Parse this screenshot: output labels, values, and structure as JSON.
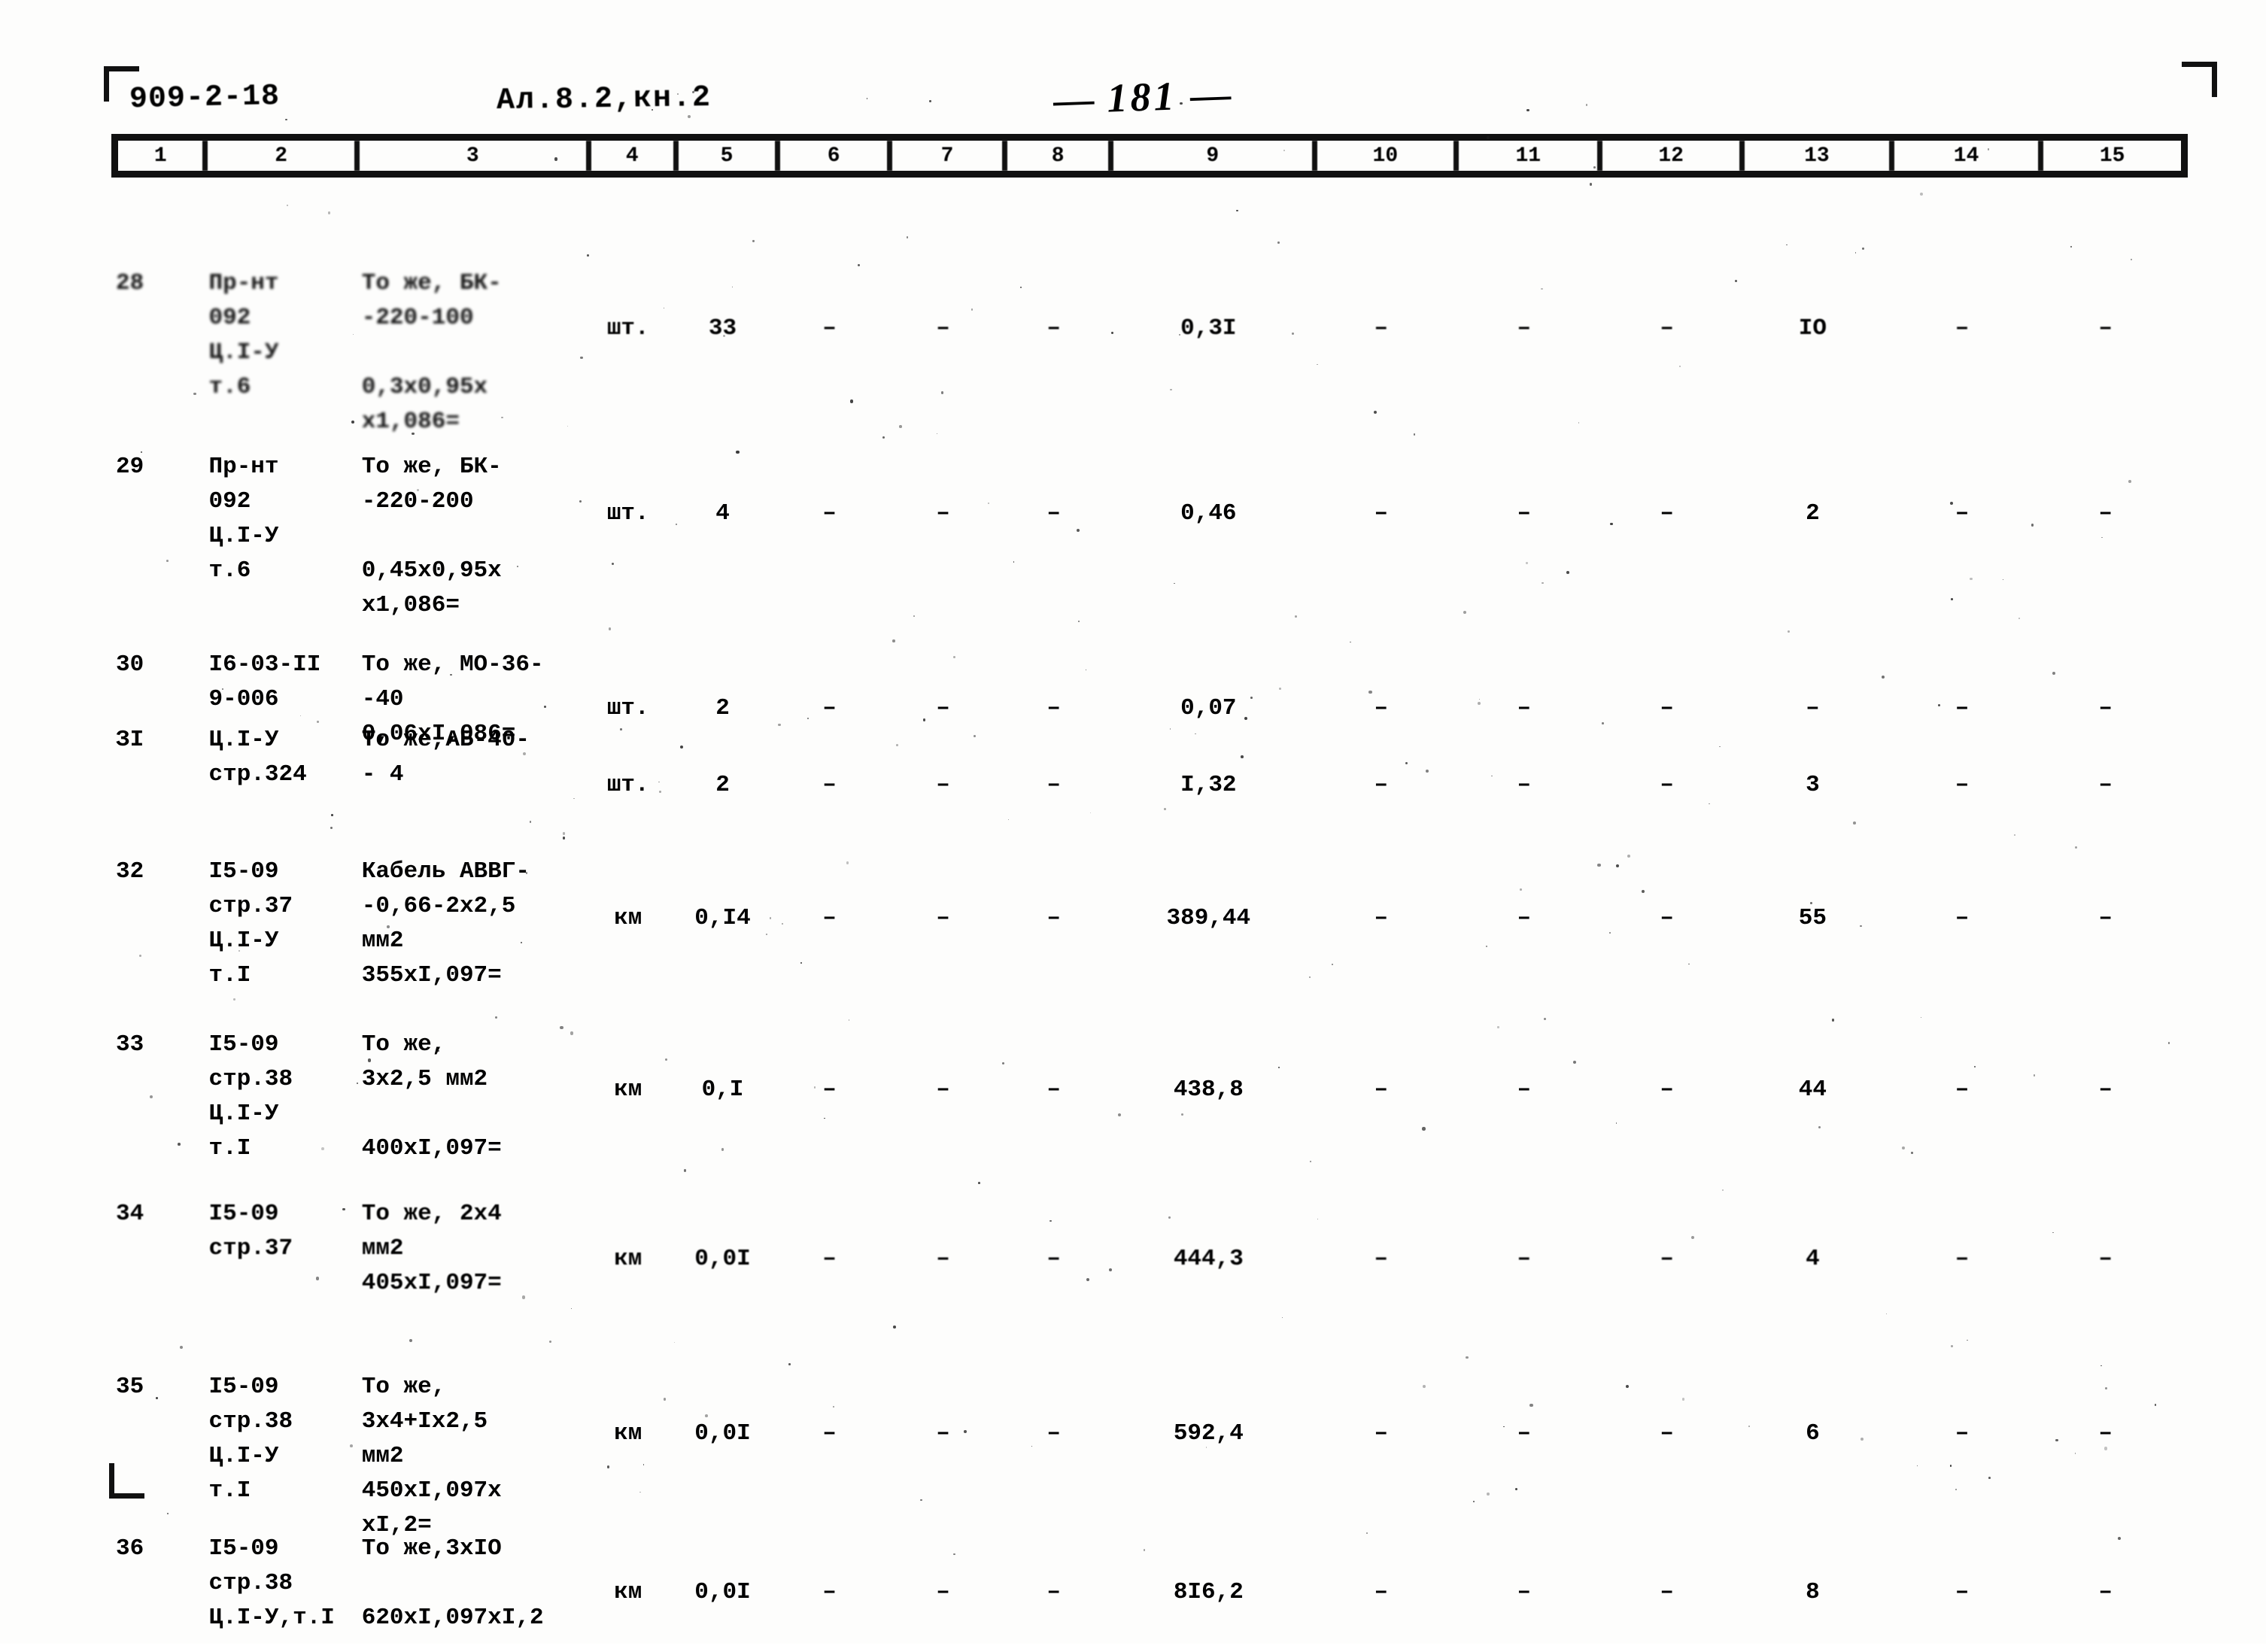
{
  "header": {
    "doc_code": "909-2-18",
    "album": "Ал.8.2,кн.2",
    "page_number": "181",
    "page_dash_left": "—",
    "page_dash_right": "—"
  },
  "table": {
    "column_headers": [
      "1",
      "2",
      "3",
      "4",
      "5",
      "6",
      "7",
      "8",
      "9",
      "10",
      "11",
      "12",
      "13",
      "14",
      "15"
    ],
    "rows": [
      {
        "num": "28",
        "code": "Пр-нт\n092\nЦ.I-У\nт.6",
        "name": "То же, БК-\n-220-100\n\n0,3x0,95x\nx1,086=",
        "unit": "шт.",
        "qty": "33",
        "c6": "–",
        "c7": "–",
        "c8": "–",
        "c9": "0,3I",
        "c10": "–",
        "c11": "–",
        "c12": "–",
        "c13": "IO",
        "c14": "–",
        "c15": "–",
        "damaged": true
      },
      {
        "num": "29",
        "code": "Пр-нт\n092\nЦ.I-У\nт.6",
        "name": "То же, БК-\n-220-200\n\n0,45x0,95x\nx1,086=",
        "unit": "шт.",
        "qty": "4",
        "c6": "–",
        "c7": "–",
        "c8": "–",
        "c9": "0,46",
        "c10": "–",
        "c11": "–",
        "c12": "–",
        "c13": "2",
        "c14": "–",
        "c15": "–",
        "damaged": false
      },
      {
        "num": "30",
        "code": "I6-03-II\n9-006",
        "name": "То же, МО-36-\n-40\n0,06xI,086=",
        "unit": "шт.",
        "qty": "2",
        "c6": "–",
        "c7": "–",
        "c8": "–",
        "c9": "0,07",
        "c10": "–",
        "c11": "–",
        "c12": "–",
        "c13": "–",
        "c14": "–",
        "c15": "–",
        "damaged": false
      },
      {
        "num": "ЗI",
        "code": "Ц.I-У\nстр.324",
        "name": "То же,АБ-40-\n- 4",
        "unit": "шт.",
        "qty": "2",
        "c6": "–",
        "c7": "–",
        "c8": "–",
        "c9": "I,32",
        "c10": "–",
        "c11": "–",
        "c12": "–",
        "c13": "3",
        "c14": "–",
        "c15": "–",
        "damaged": false
      },
      {
        "num": "32",
        "code": "I5-09\nстр.37\nЦ.I-У\nт.I",
        "name": "Кабель АВВГ-\n-0,66-2x2,5\nмм2\n355xI,097=",
        "unit": "км",
        "qty": "0,I4",
        "c6": "–",
        "c7": "–",
        "c8": "–",
        "c9": "389,44",
        "c10": "–",
        "c11": "–",
        "c12": "–",
        "c13": "55",
        "c14": "–",
        "c15": "–",
        "damaged": false
      },
      {
        "num": "33",
        "code": "I5-09\nстр.38\nЦ.I-У\nт.I",
        "name": "То же,\n3x2,5 мм2\n\n400xI,097=",
        "unit": "км",
        "qty": "0,I",
        "c6": "–",
        "c7": "–",
        "c8": "–",
        "c9": "438,8",
        "c10": "–",
        "c11": "–",
        "c12": "–",
        "c13": "44",
        "c14": "–",
        "c15": "–",
        "damaged": false
      },
      {
        "num": "34",
        "code": "I5-09\nстр.37",
        "name": "То же, 2x4\nмм2\n405xI,097=",
        "unit": "км",
        "qty": "0,0I",
        "c6": "–",
        "c7": "–",
        "c8": "–",
        "c9": "444,3",
        "c10": "–",
        "c11": "–",
        "c12": "–",
        "c13": "4",
        "c14": "–",
        "c15": "–",
        "damaged": true
      },
      {
        "num": "35",
        "code": "I5-09\nстр.38\nЦ.I-У\nт.I",
        "name": "То же,\n3x4+Ix2,5\nмм2\n450xI,097x\nxI,2=",
        "unit": "км",
        "qty": "0,0I",
        "c6": "–",
        "c7": "–",
        "c8": "–",
        "c9": "592,4",
        "c10": "–",
        "c11": "–",
        "c12": "–",
        "c13": "6",
        "c14": "–",
        "c15": "–",
        "damaged": false
      },
      {
        "num": "36",
        "code": "I5-09\nстр.38\nЦ.I-У,т.I",
        "name": "То же,3xIO\n\n620xI,097xI,2",
        "unit": "км",
        "qty": "0,0I",
        "c6": "–",
        "c7": "–",
        "c8": "–",
        "c9": "8I6,2",
        "c10": "–",
        "c11": "–",
        "c12": "–",
        "c13": "8",
        "c14": "–",
        "c15": "–",
        "damaged": false
      }
    ]
  },
  "colors": {
    "ink": "#111111",
    "paper": "#ffffff"
  }
}
